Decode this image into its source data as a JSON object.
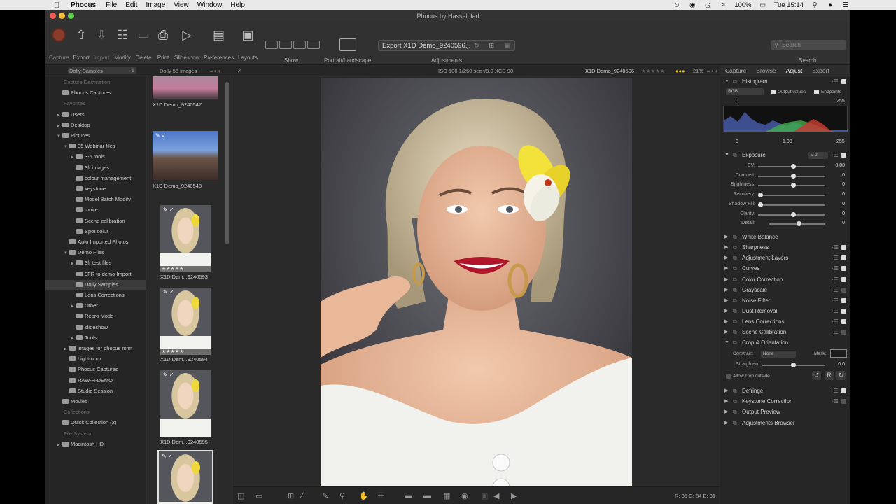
{
  "menubar": {
    "app": "Phocus",
    "items": [
      "File",
      "Edit",
      "Image",
      "View",
      "Window",
      "Help"
    ],
    "battery": "100%",
    "clock": "Tue 15:14"
  },
  "window": {
    "title": "Phocus by Hasselblad"
  },
  "toolbar": {
    "capture": "Capture",
    "export": "Export",
    "import": "Import",
    "modify": "Modify",
    "delete": "Delete",
    "print": "Print",
    "slideshow": "Slideshow",
    "preferences": "Preferences",
    "layouts": "Layouts",
    "show": "Show",
    "portrait_landscape": "Portrait/Landscape",
    "adjust_preset": "Export X1D Demo_9240596.j...",
    "adjustments": "Adjustments",
    "search_placeholder": "Search",
    "search_label": "Search"
  },
  "subbar": {
    "source": "Dolly Samples",
    "count": "Dolly 55 images",
    "exif": "ISO 100   1/250 sec  f/9.0   XCD 90",
    "filename": "X1D Demo_9240596",
    "zoom": "21%"
  },
  "sidebar": {
    "rows": [
      {
        "label": "Capture Destination",
        "type": "section",
        "indent": 0
      },
      {
        "label": "Phocus Captures",
        "type": "folder",
        "indent": 1
      },
      {
        "label": "Favorites",
        "type": "section",
        "indent": 0
      },
      {
        "label": "Users",
        "type": "folder",
        "indent": 1,
        "arrow": "right"
      },
      {
        "label": "Desktop",
        "type": "folder",
        "indent": 1,
        "arrow": "right"
      },
      {
        "label": "Pictures",
        "type": "folder",
        "indent": 1,
        "arrow": "down"
      },
      {
        "label": "35 Webinar files",
        "type": "folder",
        "indent": 2,
        "arrow": "down"
      },
      {
        "label": "3-5 tools",
        "type": "folder",
        "indent": 3,
        "arrow": "right"
      },
      {
        "label": "3fr images",
        "type": "folder",
        "indent": 3
      },
      {
        "label": "colour management",
        "type": "folder",
        "indent": 3
      },
      {
        "label": "keystone",
        "type": "folder",
        "indent": 3
      },
      {
        "label": "Model Batch Modify",
        "type": "folder",
        "indent": 3
      },
      {
        "label": "moire",
        "type": "folder",
        "indent": 3
      },
      {
        "label": "Scene calibration",
        "type": "folder",
        "indent": 3
      },
      {
        "label": "Spot colur",
        "type": "folder",
        "indent": 3
      },
      {
        "label": "Auto Imported Photos",
        "type": "folder",
        "indent": 2
      },
      {
        "label": "Demo Files",
        "type": "folder",
        "indent": 2,
        "arrow": "down"
      },
      {
        "label": "3fr test files",
        "type": "folder",
        "indent": 3,
        "arrow": "right"
      },
      {
        "label": "3FR to demo Import",
        "type": "folder",
        "indent": 3
      },
      {
        "label": "Dolly Samples",
        "type": "folder",
        "indent": 3,
        "selected": true
      },
      {
        "label": "Lens Corrections",
        "type": "folder",
        "indent": 3
      },
      {
        "label": "Other",
        "type": "folder",
        "indent": 3,
        "arrow": "right"
      },
      {
        "label": "Repro Mode",
        "type": "folder",
        "indent": 3
      },
      {
        "label": "slideshow",
        "type": "folder",
        "indent": 3
      },
      {
        "label": "Tools",
        "type": "folder",
        "indent": 3,
        "arrow": "right"
      },
      {
        "label": "images for phocus mfm",
        "type": "folder",
        "indent": 2,
        "arrow": "right"
      },
      {
        "label": "Lightroom",
        "type": "folder",
        "indent": 2
      },
      {
        "label": "Phocus Captures",
        "type": "folder",
        "indent": 2
      },
      {
        "label": "RAW-H-DEMO",
        "type": "folder",
        "indent": 2
      },
      {
        "label": "Studio Session",
        "type": "folder",
        "indent": 2
      },
      {
        "label": "Movies",
        "type": "folder",
        "indent": 1
      },
      {
        "label": "Collections",
        "type": "section",
        "indent": 0
      },
      {
        "label": "Quick Collection (2)",
        "type": "collection",
        "indent": 1
      },
      {
        "label": "File System",
        "type": "section",
        "indent": 0
      },
      {
        "label": "Macintosh HD",
        "type": "drive",
        "indent": 1,
        "arrow": "right"
      }
    ]
  },
  "thumbnails": [
    {
      "caption": "X1D Demo_9240547",
      "stars": "",
      "kind": "landscape-pink"
    },
    {
      "caption": "X1D Demo_9240548",
      "stars": "",
      "kind": "landscape-building"
    },
    {
      "caption": "X1D Dem...9240593",
      "stars": "★★★★★",
      "kind": "portrait"
    },
    {
      "caption": "X1D Dem...9240594",
      "stars": "★★★★★",
      "kind": "portrait"
    },
    {
      "caption": "X1D Dem...9240595",
      "stars": "",
      "kind": "portrait"
    },
    {
      "caption": "",
      "stars": "",
      "kind": "portrait-selected"
    }
  ],
  "viewer": {
    "rgb": "R:  85  G:  84  B:  81"
  },
  "right_panel": {
    "tabs": [
      "Capture",
      "Browse",
      "Adjust",
      "Export"
    ],
    "active_tab": "Adjust",
    "histogram": {
      "title": "Histogram",
      "channel": "RGB",
      "output_values": "Output values",
      "endpoints": "Endpoints",
      "low": "0",
      "high": "255",
      "bottom_low": "0",
      "gamma": "1.00",
      "bottom_high": "255"
    },
    "exposure": {
      "title": "Exposure",
      "version": "V 2",
      "sliders": [
        {
          "label": "EV:",
          "value": "0,00",
          "pos": 0.5
        },
        {
          "label": "Contrast:",
          "value": "0",
          "pos": 0.5
        },
        {
          "label": "Brightness:",
          "value": "0",
          "pos": 0.5
        },
        {
          "label": "Recovery:",
          "value": "0",
          "pos": 0.0
        },
        {
          "label": "Shadow Fill:",
          "value": "0",
          "pos": 0.0
        },
        {
          "label": "Clarity:",
          "value": "0",
          "pos": 0.5
        },
        {
          "label": "Detail:",
          "value": "0",
          "pos": 0.5
        }
      ]
    },
    "tools_mid": [
      {
        "name": "White Balance",
        "menu": false,
        "check": "none"
      },
      {
        "name": "Sharpness",
        "menu": true,
        "check": "on"
      },
      {
        "name": "Adjustment Layers",
        "menu": true,
        "check": "on"
      },
      {
        "name": "Curves",
        "menu": true,
        "check": "on"
      },
      {
        "name": "Color Correction",
        "menu": true,
        "check": "on"
      },
      {
        "name": "Grayscale",
        "menu": true,
        "check": "off"
      },
      {
        "name": "Noise Filter",
        "menu": true,
        "check": "on"
      },
      {
        "name": "Dust Removal",
        "menu": true,
        "check": "on"
      },
      {
        "name": "Lens Corrections",
        "menu": true,
        "check": "on"
      },
      {
        "name": "Scene Calibration",
        "menu": true,
        "check": "off"
      }
    ],
    "crop": {
      "title": "Crop & Orientation",
      "constrain_label": "Constrain:",
      "constrain_value": "None",
      "mask_label": "Mask:",
      "straighten_label": "Straighten:",
      "straighten_value": "0.0",
      "allow_crop": "Allow crop outside"
    },
    "tools_bottom": [
      {
        "name": "Defringe",
        "menu": true,
        "check": "on"
      },
      {
        "name": "Keystone Correction",
        "menu": true,
        "check": "off"
      },
      {
        "name": "Output Preview",
        "menu": false,
        "check": "none"
      },
      {
        "name": "Adjustments Browser",
        "menu": false,
        "check": "none"
      }
    ]
  },
  "colors": {
    "accent_red": "#8a3c2a",
    "rating_yellow": "#e8c22a"
  }
}
